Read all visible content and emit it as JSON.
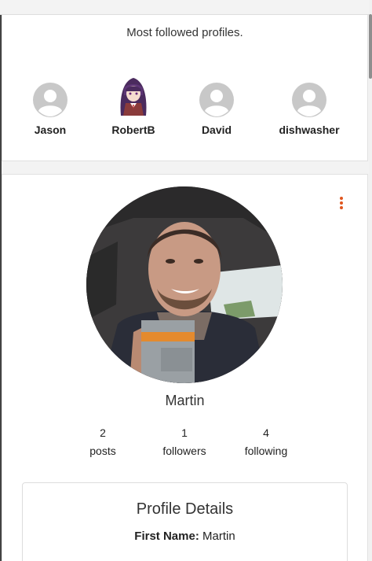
{
  "followed": {
    "title": "Most followed profiles.",
    "profiles": [
      {
        "name": "Jason",
        "avatar_icon": "default-user-icon"
      },
      {
        "name": "RobertB",
        "avatar_icon": "anime-character-avatar"
      },
      {
        "name": "David",
        "avatar_icon": "default-user-icon"
      },
      {
        "name": "dishwasher",
        "avatar_icon": "default-user-icon"
      }
    ]
  },
  "profile": {
    "name": "Martin",
    "menu_icon": "more-vertical-icon",
    "stats": [
      {
        "value": "2",
        "label": "posts"
      },
      {
        "value": "1",
        "label": "followers"
      },
      {
        "value": "4",
        "label": "following"
      }
    ],
    "details": {
      "title": "Profile Details",
      "first_name_label": "First Name:",
      "first_name_value": "Martin"
    }
  },
  "colors": {
    "accent": "#e0561f",
    "placeholder_avatar": "#c8c8c8"
  }
}
